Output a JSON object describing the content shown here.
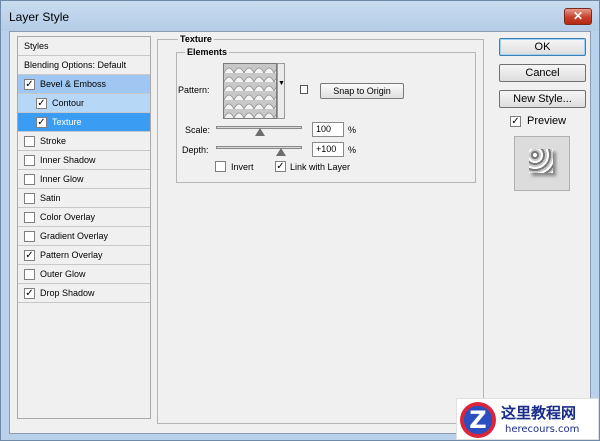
{
  "window": {
    "title": "Layer Style",
    "close_glyph": "✕"
  },
  "styles_list": {
    "header": "Styles",
    "blending_options": "Blending Options: Default",
    "items": [
      {
        "label": "Bevel & Emboss",
        "checked": true
      },
      {
        "label": "Contour",
        "checked": true
      },
      {
        "label": "Texture",
        "checked": true
      },
      {
        "label": "Stroke",
        "checked": false
      },
      {
        "label": "Inner Shadow",
        "checked": false
      },
      {
        "label": "Inner Glow",
        "checked": false
      },
      {
        "label": "Satin",
        "checked": false
      },
      {
        "label": "Color Overlay",
        "checked": false
      },
      {
        "label": "Gradient Overlay",
        "checked": false
      },
      {
        "label": "Pattern Overlay",
        "checked": true
      },
      {
        "label": "Outer Glow",
        "checked": false
      },
      {
        "label": "Drop Shadow",
        "checked": true
      }
    ]
  },
  "texture": {
    "group_title": "Texture",
    "elements_title": "Elements",
    "pattern_label": "Pattern:",
    "snap_button": "Snap to Origin",
    "scale_label": "Scale:",
    "scale_value": "100",
    "scale_unit": "%",
    "depth_label": "Depth:",
    "depth_value": "+100",
    "depth_unit": "%",
    "invert_label": "Invert",
    "invert_checked": false,
    "link_label": "Link with Layer",
    "link_checked": true
  },
  "buttons": {
    "ok": "OK",
    "cancel": "Cancel",
    "new_style": "New Style...",
    "preview_label": "Preview",
    "preview_checked": true
  },
  "watermark": {
    "logo_letter": "Z",
    "site_name": "这里教程网",
    "url": "herecours.com"
  },
  "icons": {
    "checkmark": "✓",
    "dropdown": "▼",
    "close": "close-icon"
  }
}
